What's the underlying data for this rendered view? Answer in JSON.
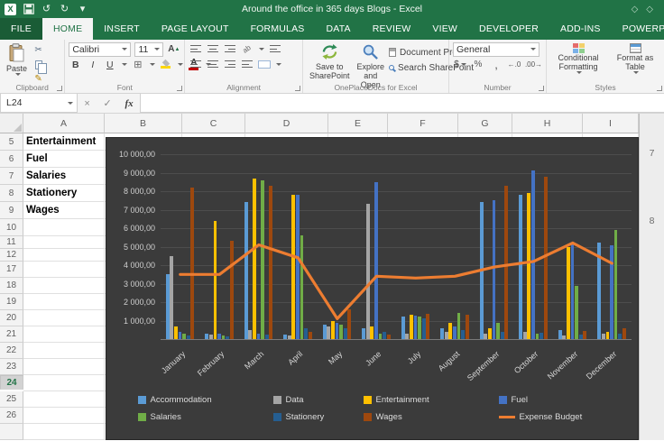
{
  "titlebar": {
    "title": "Around the office in 365 days Blogs - Excel",
    "excel_icon_letter": "X"
  },
  "icons": {
    "save": "💾",
    "undo": "↺",
    "redo": "↻",
    "dropdown": "▾",
    "diamond1": "◇",
    "diamond2": "◇",
    "cut": "✂",
    "format_painter": "✎",
    "borders": "⊞",
    "grow_font": "A",
    "shrink_font": "A",
    "orientation": "ab",
    "cancel": "×",
    "enter": "✓",
    "currency": "$",
    "percent": "%",
    "comma": ",",
    "increase_decimal": "←.0",
    "decrease_decimal": ".00→"
  },
  "tabs": {
    "items": [
      "FILE",
      "HOME",
      "INSERT",
      "PAGE LAYOUT",
      "FORMULAS",
      "DATA",
      "REVIEW",
      "VIEW",
      "DEVELOPER",
      "ADD-INS",
      "POWERPIVOT"
    ],
    "active": "HOME"
  },
  "ribbon": {
    "clipboard": {
      "label": "Clipboard",
      "paste": "Paste"
    },
    "font": {
      "label": "Font",
      "name": "Calibri",
      "size": "11",
      "bold": "B",
      "italic": "I",
      "underline": "U"
    },
    "alignment": {
      "label": "Alignment"
    },
    "oneplace": {
      "label": "OnePlaceDocs for Excel",
      "save_line1": "Save to",
      "save_line2": "SharePoint",
      "explore_line1": "Explore",
      "explore_line2": "and Open",
      "doc_props": "Document Properties",
      "search": "Search SharePoint"
    },
    "number": {
      "label": "Number",
      "format": "General"
    },
    "styles": {
      "label": "Styles",
      "conditional": "Conditional Formatting",
      "format_table": "Format as Table"
    }
  },
  "formula_bar": {
    "name_box": "L24",
    "fx": "fx",
    "formula": ""
  },
  "sheet": {
    "columns": [
      "A",
      "B",
      "C",
      "D",
      "E",
      "F",
      "G",
      "H",
      "I"
    ],
    "rows": [
      5,
      6,
      7,
      8,
      9,
      10,
      11,
      12,
      17,
      18,
      19,
      20,
      21,
      22,
      23,
      24,
      25,
      26
    ],
    "selected_cell": "L24",
    "selected_row": 24,
    "cells": {
      "A5": "Entertainment",
      "A6": "Fuel",
      "A7": "Salaries",
      "A8": "Stationery",
      "A9": "Wages"
    },
    "right_pane_rows": [
      "7",
      "8"
    ]
  },
  "chart_data": {
    "type": "combo: clustered column + line",
    "title": "",
    "categories": [
      "January",
      "February",
      "March",
      "April",
      "May",
      "June",
      "July",
      "August",
      "September",
      "October",
      "November",
      "December"
    ],
    "y_tick_labels": [
      "10 000,00",
      "9 000,00",
      "8 000,00",
      "7 000,00",
      "6 000,00",
      "5 000,00",
      "4 000,00",
      "3 000,00",
      "2 000,00",
      "1 000,00"
    ],
    "ylim": [
      0,
      10000
    ],
    "grid": "horizontal",
    "legend_position": "bottom",
    "plot_background": "#3B3B3B",
    "series": [
      {
        "name": "Accommodation",
        "type": "column",
        "color": "#5B9BD5",
        "values": [
          3500,
          300,
          7400,
          250,
          800,
          600,
          1200,
          600,
          7400,
          7800,
          500,
          5200
        ]
      },
      {
        "name": "Data",
        "type": "column",
        "color": "#A5A5A5",
        "values": [
          4500,
          250,
          500,
          200,
          700,
          7300,
          300,
          400,
          300,
          400,
          200,
          300
        ]
      },
      {
        "name": "Entertainment",
        "type": "column",
        "color": "#FFC000",
        "values": [
          700,
          6400,
          8700,
          7800,
          1000,
          700,
          1300,
          900,
          600,
          7900,
          5000,
          400
        ]
      },
      {
        "name": "Fuel",
        "type": "column",
        "color": "#4472C4",
        "values": [
          400,
          300,
          300,
          7800,
          900,
          8500,
          1250,
          700,
          7500,
          9100,
          5200,
          5100
        ]
      },
      {
        "name": "Salaries",
        "type": "column",
        "color": "#70AD47",
        "values": [
          300,
          200,
          8600,
          5600,
          800,
          300,
          1200,
          1400,
          900,
          300,
          2900,
          5900
        ]
      },
      {
        "name": "Stationery",
        "type": "column",
        "color": "#255E91",
        "values": [
          200,
          150,
          250,
          600,
          600,
          400,
          1100,
          500,
          400,
          350,
          250,
          300
        ]
      },
      {
        "name": "Wages",
        "type": "column",
        "color": "#9E480E",
        "values": [
          8200,
          5300,
          8300,
          400,
          1600,
          250,
          1350,
          1300,
          8300,
          8800,
          450,
          600
        ]
      }
    ],
    "line_series": {
      "name": "Expense Budget",
      "type": "line",
      "color": "#ED7D31",
      "values": [
        3500,
        3500,
        5100,
        4400,
        1100,
        3400,
        3300,
        3400,
        3900,
        4200,
        5200,
        4100
      ]
    },
    "legend_rows": [
      [
        "Accommodation",
        "Data",
        "Entertainment",
        "Fuel"
      ],
      [
        "Salaries",
        "Stationery",
        "Wages",
        "Expense Budget"
      ]
    ]
  }
}
